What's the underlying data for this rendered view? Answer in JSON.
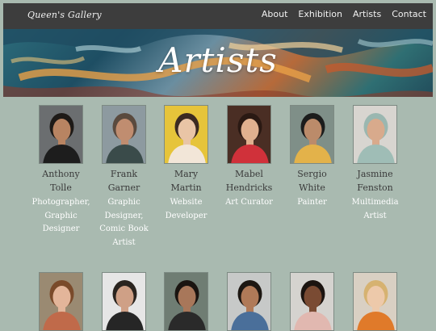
{
  "header": {
    "logo": "Queen's Gallery",
    "nav": [
      "About",
      "Exhibition",
      "Artists",
      "Contact"
    ]
  },
  "banner": {
    "title": "Artists"
  },
  "artists_row1": [
    {
      "name_line1": "Anthony",
      "name_line2": "Tolle",
      "role_lines": [
        "Photographer,",
        "Graphic",
        "Designer"
      ],
      "bg": "#6b6e70",
      "skin": "#b88462",
      "hair": "#1e1a17",
      "shirt": "#1d1d1d"
    },
    {
      "name_line1": "Frank",
      "name_line2": "Garner",
      "role_lines": [
        "Graphic",
        "Designer,",
        "Comic Book",
        "Artist"
      ],
      "bg": "#8d9aa0",
      "skin": "#c08d70",
      "hair": "#5a4a3e",
      "shirt": "#3a4b4a"
    },
    {
      "name_line1": "Mary",
      "name_line2": "Martin",
      "role_lines": [
        "Website",
        "Developer"
      ],
      "bg": "#e6c43a",
      "skin": "#e9c5a6",
      "hair": "#3b2a22",
      "shirt": "#f2e6d8"
    },
    {
      "name_line1": "Mabel",
      "name_line2": "Hendricks",
      "role_lines": [
        "Art Curator"
      ],
      "bg": "#4a2e24",
      "skin": "#e0b08f",
      "hair": "#2a1913",
      "shirt": "#d0313a"
    },
    {
      "name_line1": "Sergio",
      "name_line2": "White",
      "role_lines": [
        "Painter"
      ],
      "bg": "#7f8f88",
      "skin": "#bb8b6a",
      "hair": "#1c1c1c",
      "shirt": "#e3b24a"
    },
    {
      "name_line1": "Jasmine",
      "name_line2": "Fenston",
      "role_lines": [
        "Multimedia",
        "Artist"
      ],
      "bg": "#d8d5d0",
      "skin": "#d8aa8c",
      "hair": "#9ab7b0",
      "shirt": "#9fbdb6"
    }
  ],
  "artists_row2": [
    {
      "bg": "#9a8a72",
      "skin": "#e3b59a",
      "hair": "#7a4a2a",
      "shirt": "#c06a4a"
    },
    {
      "bg": "#e6e6e6",
      "skin": "#cfa086",
      "hair": "#2a241f",
      "shirt": "#262626"
    },
    {
      "bg": "#6f7d73",
      "skin": "#a8775a",
      "hair": "#1a1410",
      "shirt": "#2a2a2a"
    },
    {
      "bg": "#c7c9c8",
      "skin": "#b07a58",
      "hair": "#1d1712",
      "shirt": "#4a6f9a"
    },
    {
      "bg": "#d5d3cf",
      "skin": "#7a4b33",
      "hair": "#1b1410",
      "shirt": "#e1b8b0"
    },
    {
      "bg": "#d9d0c3",
      "skin": "#edc9aa",
      "hair": "#d6b271",
      "shirt": "#e07a2a"
    }
  ]
}
